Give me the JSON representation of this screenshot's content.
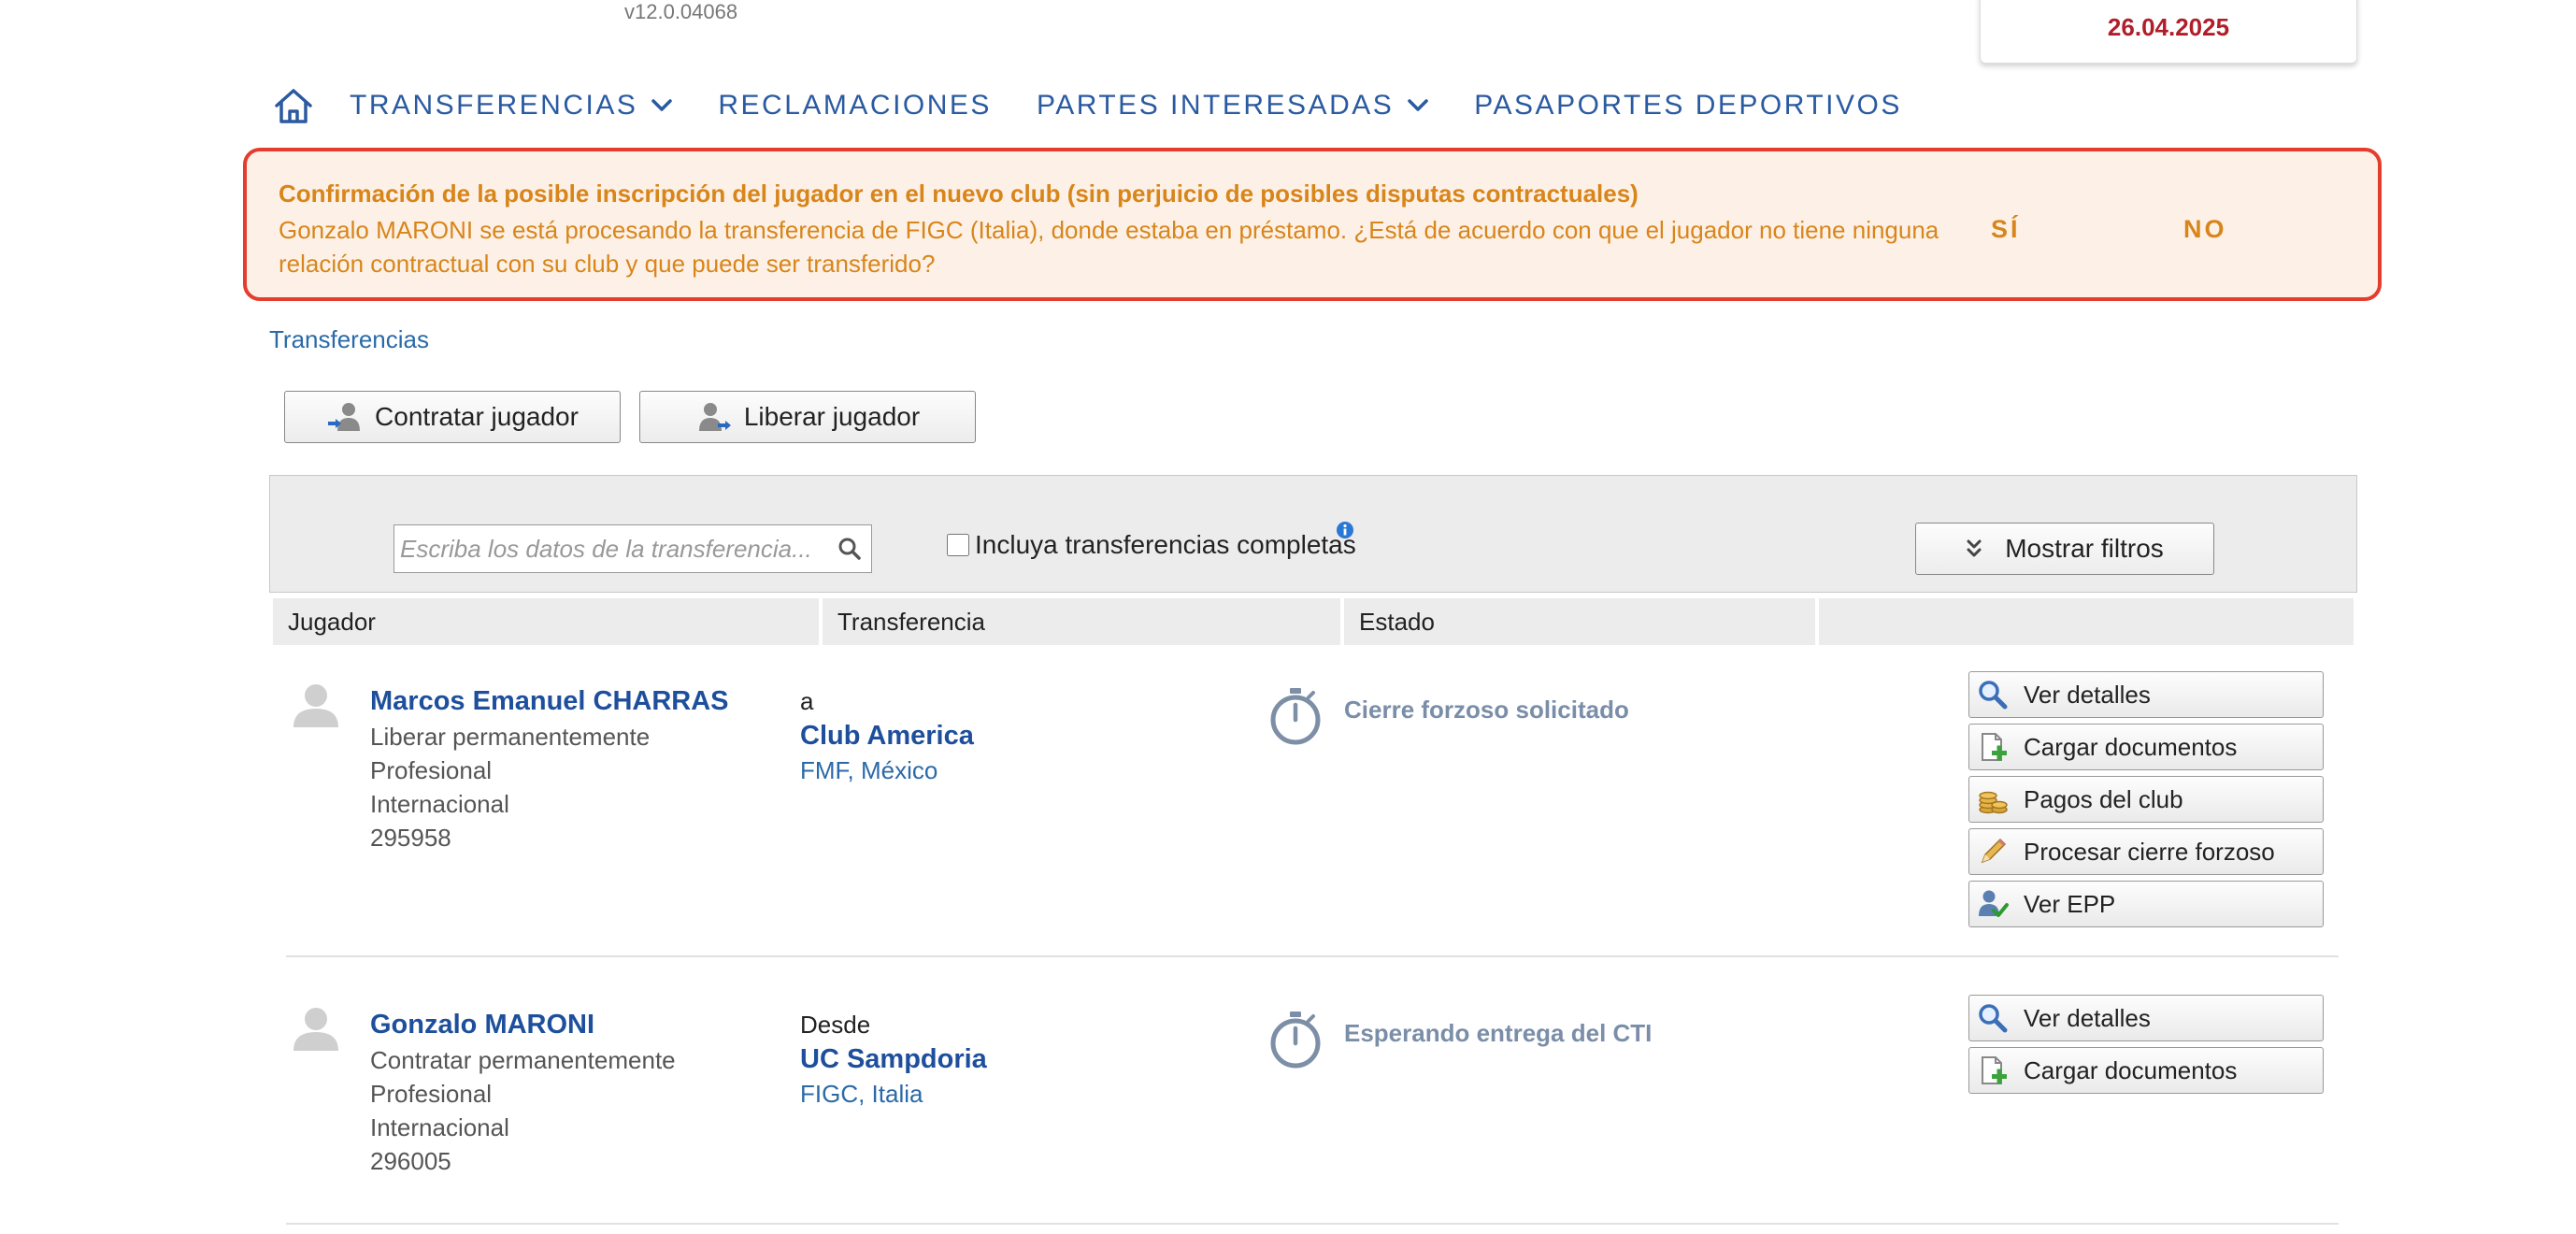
{
  "header": {
    "version": "v12.0.04068",
    "date": "26.04.2025"
  },
  "nav": {
    "items": [
      {
        "label": "TRANSFERENCIAS"
      },
      {
        "label": "RECLAMACIONES"
      },
      {
        "label": "PARTES INTERESADAS"
      },
      {
        "label": "PASAPORTES DEPORTIVOS"
      }
    ]
  },
  "alert": {
    "title": "Confirmación de la posible inscripción del jugador en el nuevo club (sin perjuicio de posibles disputas contractuales)",
    "message": "Gonzalo MARONI se está procesando la transferencia de FIGC (Italia), donde estaba en préstamo. ¿Está de acuerdo con que el jugador no tiene ninguna relación contractual con su club y que puede ser transferido?",
    "yes_label": "SÍ",
    "no_label": "NO",
    "border_color": "#e53d2d"
  },
  "breadcrumb": "Transferencias",
  "toolbar": {
    "hire_label": "Contratar jugador",
    "release_label": "Liberar jugador"
  },
  "filters": {
    "search_placeholder": "Escriba los datos de la transferencia...",
    "include_complete_label": "Incluya transferencias completas",
    "show_filters_label": "Mostrar filtros"
  },
  "table": {
    "columns": [
      "Jugador",
      "Transferencia",
      "Estado",
      ""
    ],
    "rows": [
      {
        "name": "Marcos Emanuel CHARRAS",
        "type": "Liberar permanentemente",
        "level": "Profesional",
        "scope": "Internacional",
        "id": "295958",
        "direction": "a",
        "club": "Club America",
        "association": "FMF, México",
        "status": "Cierre forzoso solicitado",
        "actions": [
          "Ver detalles",
          "Cargar documentos",
          "Pagos del club",
          "Procesar cierre forzoso",
          "Ver EPP"
        ]
      },
      {
        "name": "Gonzalo MARONI",
        "type": "Contratar permanentemente",
        "level": "Profesional",
        "scope": "Internacional",
        "id": "296005",
        "direction": "Desde",
        "club": "UC Sampdoria",
        "association": "FIGC, Italia",
        "status": "Esperando entrega del CTI",
        "actions": [
          "Ver detalles",
          "Cargar documentos"
        ]
      }
    ]
  }
}
